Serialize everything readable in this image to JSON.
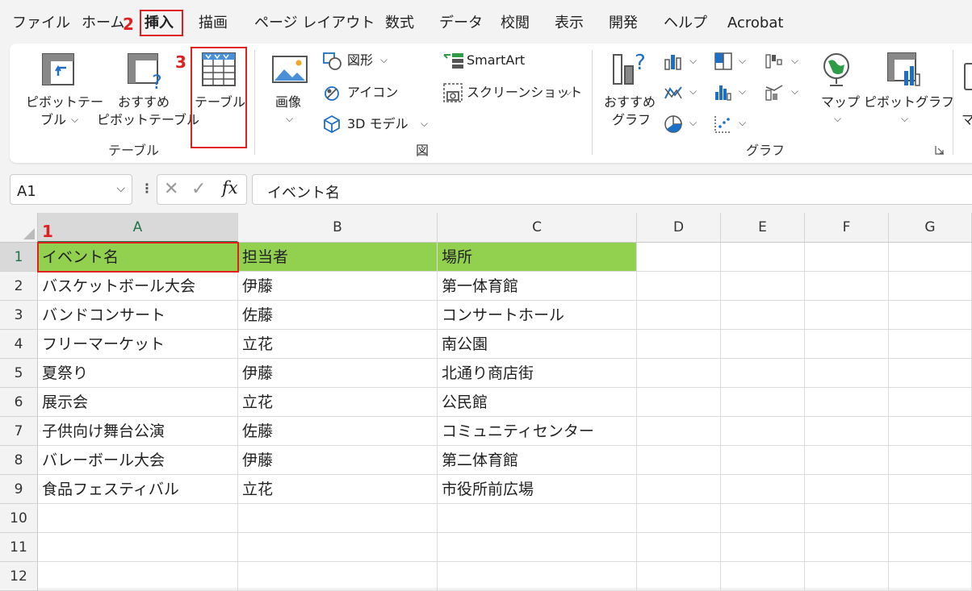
{
  "menu": {
    "tabs": [
      "ファイル",
      "ホーム",
      "挿入",
      "描画",
      "ページ レイアウト",
      "数式",
      "データ",
      "校閲",
      "表示",
      "開発",
      "ヘルプ",
      "Acrobat"
    ],
    "active_tab": "挿入"
  },
  "annotations": {
    "step1": "1",
    "step2": "2",
    "step3": "3"
  },
  "ribbon": {
    "groups": {
      "table": "テーブル",
      "illustration": "図",
      "chart": "グラフ"
    },
    "pivot_table": {
      "line1": "ピボットテー",
      "line2": "ブル"
    },
    "recommended_pivot": {
      "line1": "おすすめ",
      "line2": "ピボットテーブル"
    },
    "table_button": "テーブル",
    "image_button": "画像",
    "shapes": "図形",
    "icons": "アイコン",
    "models_3d": "3D モデル",
    "smartart": "SmartArt",
    "screenshot": "スクリーンショット",
    "recommended_charts": {
      "line1": "おすすめ",
      "line2": "グラフ"
    },
    "map": "マップ",
    "pivot_chart": "ピボットグラフ",
    "next_item_partial": "マ"
  },
  "formula_bar": {
    "name_box": "A1",
    "fx": "fx",
    "value": "イベント名"
  },
  "sheet": {
    "columns": [
      "A",
      "B",
      "C",
      "D",
      "E",
      "F",
      "G"
    ],
    "rows": [
      [
        "イベント名",
        "担当者",
        "場所"
      ],
      [
        "バスケットボール大会",
        "伊藤",
        "第一体育館"
      ],
      [
        "バンドコンサート",
        "佐藤",
        "コンサートホール"
      ],
      [
        "フリーマーケット",
        "立花",
        "南公園"
      ],
      [
        "夏祭り",
        "伊藤",
        "北通り商店街"
      ],
      [
        "展示会",
        "立花",
        "公民館"
      ],
      [
        "子供向け舞台公演",
        "佐藤",
        "コミュニティセンター"
      ],
      [
        "バレーボール大会",
        "伊藤",
        "第二体育館"
      ],
      [
        "食品フェスティバル",
        "立花",
        "市役所前広場"
      ],
      [
        "",
        "",
        ""
      ],
      [
        "",
        "",
        ""
      ],
      [
        "",
        "",
        ""
      ]
    ],
    "row_numbers": [
      "1",
      "2",
      "3",
      "4",
      "5",
      "6",
      "7",
      "8",
      "9",
      "10",
      "11",
      "12"
    ],
    "header_fill": "#92d050"
  },
  "colors": {
    "highlight_red": "#e0201f",
    "excel_green": "#217346"
  }
}
